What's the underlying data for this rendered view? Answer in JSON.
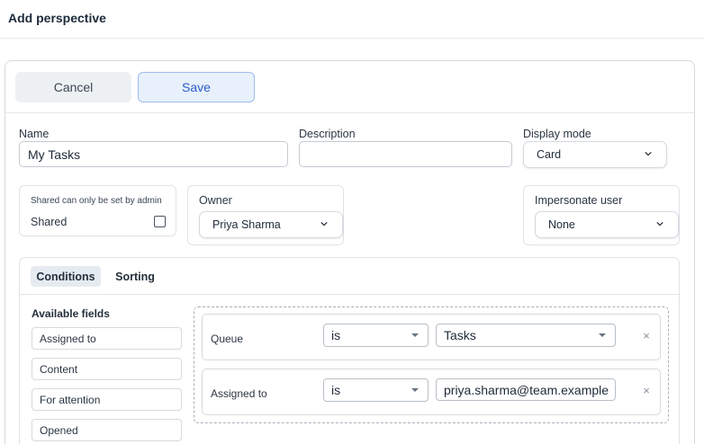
{
  "header": {
    "title": "Add perspective"
  },
  "toolbar": {
    "cancel_label": "Cancel",
    "save_label": "Save"
  },
  "form": {
    "name_label": "Name",
    "name_value": "My Tasks",
    "description_label": "Description",
    "description_value": "",
    "display_mode_label": "Display mode",
    "display_mode_value": "Card",
    "shared_note": "Shared can only be set by admin",
    "shared_label": "Shared",
    "shared_checked": false,
    "owner_label": "Owner",
    "owner_value": "Priya Sharma",
    "impersonate_label": "Impersonate user",
    "impersonate_value": "None"
  },
  "tabs": [
    {
      "label": "Conditions",
      "active": true
    },
    {
      "label": "Sorting",
      "active": false
    }
  ],
  "available_fields": {
    "title": "Available fields",
    "items": [
      "Assigned to",
      "Content",
      "For attention",
      "Opened"
    ]
  },
  "conditions": [
    {
      "field": "Queue",
      "operator": "is",
      "value": "Tasks"
    },
    {
      "field": "Assigned to",
      "operator": "is",
      "value": "priya.sharma@team.example"
    }
  ],
  "icons": {
    "remove": "×"
  },
  "colors": {
    "accent": "#2a5dc9",
    "save_bg": "#e8f0fc",
    "save_border": "#9ebcf0"
  }
}
